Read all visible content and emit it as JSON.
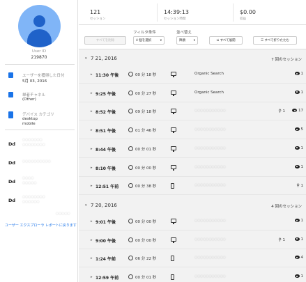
{
  "profile": {
    "uid_label": "User ID",
    "uid_value": "219870"
  },
  "info": [
    {
      "icon": "calendar-icon",
      "color": "#1a73e8",
      "label": "ユーザーを獲得した日付",
      "value": "5月 03, 2016"
    },
    {
      "icon": "bar-chart-icon",
      "color": "#1a73e8",
      "label": "単者チャネル",
      "value": "(Other)"
    },
    {
      "icon": "device-icon",
      "color": "#1a73e8",
      "label": "デバイス カテゴリ",
      "value": "desktop",
      "value2": "mobile"
    }
  ],
  "dd_label": "Dd",
  "report_link": "ユーザー エクスプローラ レポートに戻ります",
  "stats": {
    "sessions_value": "121",
    "sessions_caption": "セッション",
    "duration_value": "14:39:13",
    "duration_caption": "セッション時間",
    "revenue_value": "$0.00",
    "revenue_caption": "収益"
  },
  "controls": {
    "delete_label": "すべてを削除",
    "filter_label": "フィルタ条件",
    "filter_select": "4 個を選択",
    "sort_label": "並べ替え",
    "sort_select": "降順",
    "expand_all": "すべて展開",
    "collapse_all": "すべて折りたたむ"
  },
  "groups": [
    {
      "date": "7 21, 2016",
      "count": "7 回のセッション",
      "rows": [
        {
          "time": "11:30 午後",
          "duration": "00 分 18 秒",
          "device": "desktop",
          "source": "Organic Search",
          "search": "",
          "views": "1"
        },
        {
          "time": "9:25 午後",
          "duration": "00 分 27 秒",
          "device": "desktop",
          "source": "Organic Search",
          "search": "",
          "views": "1"
        },
        {
          "time": "8:52 午後",
          "duration": "09 分 18 秒",
          "device": "desktop",
          "source": "",
          "search": "1",
          "views": "17"
        },
        {
          "time": "8:51 午後",
          "duration": "01 分 46 秒",
          "device": "desktop",
          "source": "",
          "search": "",
          "views": "5"
        },
        {
          "time": "8:44 午後",
          "duration": "00 分 01 秒",
          "device": "desktop",
          "source": "",
          "search": "",
          "views": "1"
        },
        {
          "time": "8:10 午後",
          "duration": "00 分 00 秒",
          "device": "desktop",
          "source": "",
          "search": "",
          "views": "1"
        },
        {
          "time": "12:51 午前",
          "duration": "00 分 38 秒",
          "device": "mobile",
          "source": "",
          "search": "1",
          "views": ""
        }
      ]
    },
    {
      "date": "7 20, 2016",
      "count": "4 回のセッション",
      "rows": [
        {
          "time": "9:01 午後",
          "duration": "00 分 00 秒",
          "device": "desktop",
          "source": "",
          "search": "",
          "views": "1"
        },
        {
          "time": "9:00 午後",
          "duration": "00 分 00 秒",
          "device": "desktop",
          "source": "",
          "search": "1",
          "views": "1"
        },
        {
          "time": "1:24 午前",
          "duration": "06 分 22 秒",
          "device": "mobile",
          "source": "",
          "search": "",
          "views": "4"
        },
        {
          "time": "12:59 午前",
          "duration": "00 分 01 秒",
          "device": "mobile",
          "source": "",
          "search": "",
          "views": "1"
        }
      ]
    }
  ]
}
